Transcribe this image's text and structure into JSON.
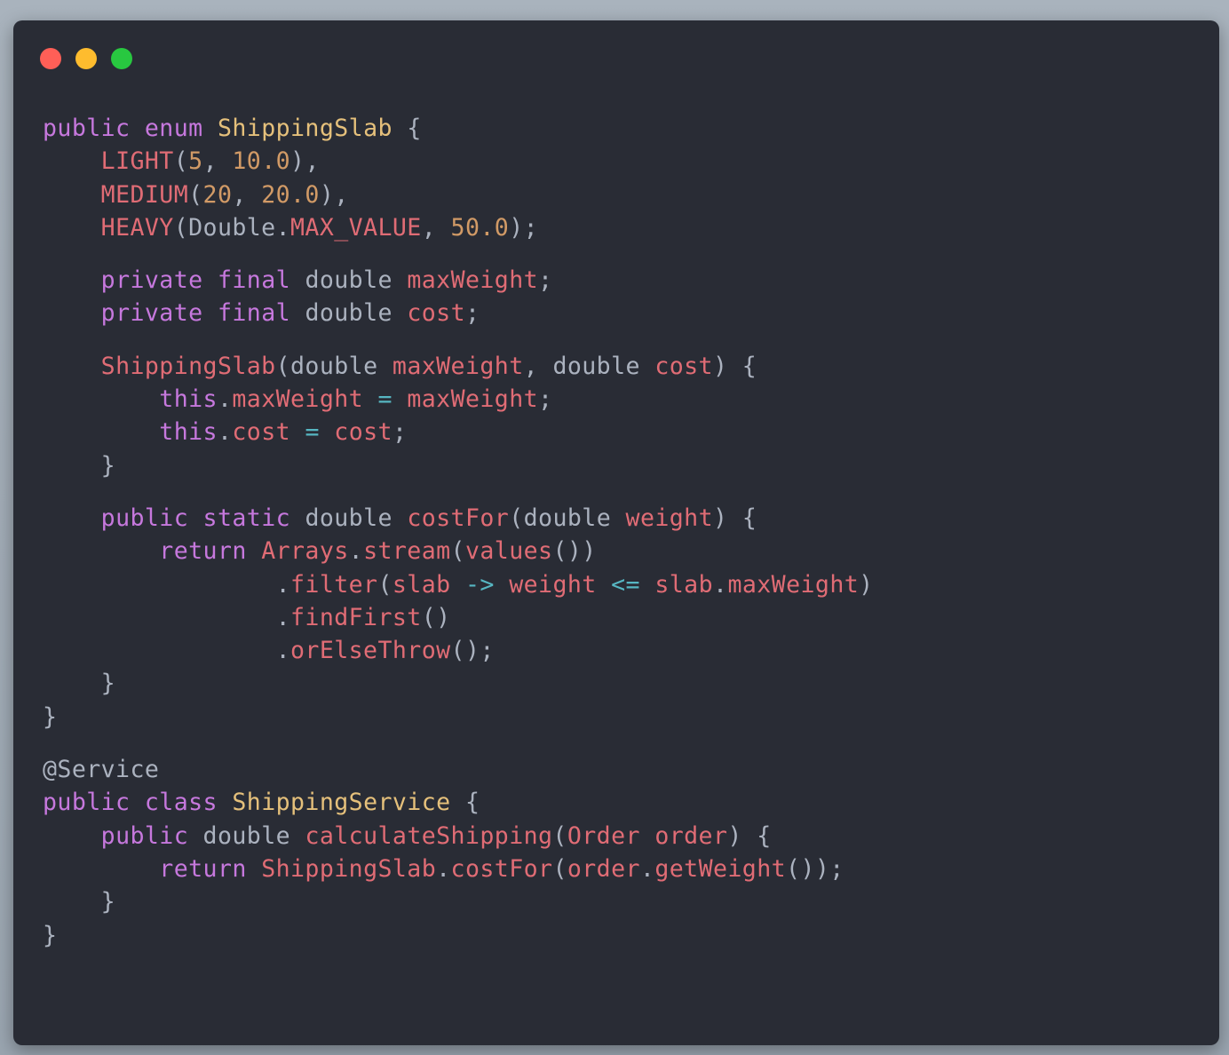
{
  "window": {
    "traffic_lights": [
      {
        "name": "close",
        "color": "#ff5f57"
      },
      {
        "name": "minimize",
        "color": "#febc2e"
      },
      {
        "name": "zoom",
        "color": "#28c840"
      }
    ]
  },
  "code": {
    "language": "java",
    "lines": [
      {
        "gap": false,
        "tokens": [
          {
            "t": "kw",
            "v": "public"
          },
          {
            "t": "plain",
            "v": " "
          },
          {
            "t": "kw",
            "v": "enum"
          },
          {
            "t": "plain",
            "v": " "
          },
          {
            "t": "type",
            "v": "ShippingSlab"
          },
          {
            "t": "punc",
            "v": " {"
          }
        ]
      },
      {
        "gap": false,
        "tokens": [
          {
            "t": "plain",
            "v": "    "
          },
          {
            "t": "const",
            "v": "LIGHT"
          },
          {
            "t": "punc",
            "v": "("
          },
          {
            "t": "num",
            "v": "5"
          },
          {
            "t": "punc",
            "v": ", "
          },
          {
            "t": "num",
            "v": "10.0"
          },
          {
            "t": "punc",
            "v": "),"
          }
        ]
      },
      {
        "gap": false,
        "tokens": [
          {
            "t": "plain",
            "v": "    "
          },
          {
            "t": "const",
            "v": "MEDIUM"
          },
          {
            "t": "punc",
            "v": "("
          },
          {
            "t": "num",
            "v": "20"
          },
          {
            "t": "punc",
            "v": ", "
          },
          {
            "t": "num",
            "v": "20.0"
          },
          {
            "t": "punc",
            "v": "),"
          }
        ]
      },
      {
        "gap": false,
        "tokens": [
          {
            "t": "plain",
            "v": "    "
          },
          {
            "t": "const",
            "v": "HEAVY"
          },
          {
            "t": "punc",
            "v": "(Double."
          },
          {
            "t": "const",
            "v": "MAX_VALUE"
          },
          {
            "t": "punc",
            "v": ", "
          },
          {
            "t": "num",
            "v": "50.0"
          },
          {
            "t": "punc",
            "v": ");"
          }
        ]
      },
      {
        "gap": true,
        "tokens": []
      },
      {
        "gap": false,
        "tokens": [
          {
            "t": "plain",
            "v": "    "
          },
          {
            "t": "kw",
            "v": "private"
          },
          {
            "t": "plain",
            "v": " "
          },
          {
            "t": "kw",
            "v": "final"
          },
          {
            "t": "plain",
            "v": " "
          },
          {
            "t": "prim",
            "v": "double"
          },
          {
            "t": "plain",
            "v": " "
          },
          {
            "t": "field",
            "v": "maxWeight"
          },
          {
            "t": "punc",
            "v": ";"
          }
        ]
      },
      {
        "gap": false,
        "tokens": [
          {
            "t": "plain",
            "v": "    "
          },
          {
            "t": "kw",
            "v": "private"
          },
          {
            "t": "plain",
            "v": " "
          },
          {
            "t": "kw",
            "v": "final"
          },
          {
            "t": "plain",
            "v": " "
          },
          {
            "t": "prim",
            "v": "double"
          },
          {
            "t": "plain",
            "v": " "
          },
          {
            "t": "field",
            "v": "cost"
          },
          {
            "t": "punc",
            "v": ";"
          }
        ]
      },
      {
        "gap": true,
        "tokens": []
      },
      {
        "gap": false,
        "tokens": [
          {
            "t": "plain",
            "v": "    "
          },
          {
            "t": "fn",
            "v": "ShippingSlab"
          },
          {
            "t": "punc",
            "v": "("
          },
          {
            "t": "prim",
            "v": "double"
          },
          {
            "t": "plain",
            "v": " "
          },
          {
            "t": "field",
            "v": "maxWeight"
          },
          {
            "t": "punc",
            "v": ", "
          },
          {
            "t": "prim",
            "v": "double"
          },
          {
            "t": "plain",
            "v": " "
          },
          {
            "t": "field",
            "v": "cost"
          },
          {
            "t": "punc",
            "v": ") {"
          }
        ]
      },
      {
        "gap": false,
        "tokens": [
          {
            "t": "plain",
            "v": "        "
          },
          {
            "t": "kw",
            "v": "this"
          },
          {
            "t": "punc",
            "v": "."
          },
          {
            "t": "field",
            "v": "maxWeight"
          },
          {
            "t": "plain",
            "v": " "
          },
          {
            "t": "op",
            "v": "="
          },
          {
            "t": "plain",
            "v": " "
          },
          {
            "t": "field",
            "v": "maxWeight"
          },
          {
            "t": "punc",
            "v": ";"
          }
        ]
      },
      {
        "gap": false,
        "tokens": [
          {
            "t": "plain",
            "v": "        "
          },
          {
            "t": "kw",
            "v": "this"
          },
          {
            "t": "punc",
            "v": "."
          },
          {
            "t": "field",
            "v": "cost"
          },
          {
            "t": "plain",
            "v": " "
          },
          {
            "t": "op",
            "v": "="
          },
          {
            "t": "plain",
            "v": " "
          },
          {
            "t": "field",
            "v": "cost"
          },
          {
            "t": "punc",
            "v": ";"
          }
        ]
      },
      {
        "gap": false,
        "tokens": [
          {
            "t": "plain",
            "v": "    "
          },
          {
            "t": "punc",
            "v": "}"
          }
        ]
      },
      {
        "gap": true,
        "tokens": []
      },
      {
        "gap": false,
        "tokens": [
          {
            "t": "plain",
            "v": "    "
          },
          {
            "t": "kw",
            "v": "public"
          },
          {
            "t": "plain",
            "v": " "
          },
          {
            "t": "kw",
            "v": "static"
          },
          {
            "t": "plain",
            "v": " "
          },
          {
            "t": "prim",
            "v": "double"
          },
          {
            "t": "plain",
            "v": " "
          },
          {
            "t": "fn",
            "v": "costFor"
          },
          {
            "t": "punc",
            "v": "("
          },
          {
            "t": "prim",
            "v": "double"
          },
          {
            "t": "plain",
            "v": " "
          },
          {
            "t": "field",
            "v": "weight"
          },
          {
            "t": "punc",
            "v": ") {"
          }
        ]
      },
      {
        "gap": false,
        "tokens": [
          {
            "t": "plain",
            "v": "        "
          },
          {
            "t": "kw",
            "v": "return"
          },
          {
            "t": "plain",
            "v": " "
          },
          {
            "t": "fn",
            "v": "Arrays"
          },
          {
            "t": "punc",
            "v": "."
          },
          {
            "t": "fn",
            "v": "stream"
          },
          {
            "t": "punc",
            "v": "("
          },
          {
            "t": "fn",
            "v": "values"
          },
          {
            "t": "punc",
            "v": "())"
          }
        ]
      },
      {
        "gap": false,
        "tokens": [
          {
            "t": "plain",
            "v": "                "
          },
          {
            "t": "punc",
            "v": "."
          },
          {
            "t": "fn",
            "v": "filter"
          },
          {
            "t": "punc",
            "v": "("
          },
          {
            "t": "field",
            "v": "slab"
          },
          {
            "t": "plain",
            "v": " "
          },
          {
            "t": "op",
            "v": "->"
          },
          {
            "t": "plain",
            "v": " "
          },
          {
            "t": "field",
            "v": "weight"
          },
          {
            "t": "plain",
            "v": " "
          },
          {
            "t": "op",
            "v": "<="
          },
          {
            "t": "plain",
            "v": " "
          },
          {
            "t": "field",
            "v": "slab"
          },
          {
            "t": "punc",
            "v": "."
          },
          {
            "t": "field",
            "v": "maxWeight"
          },
          {
            "t": "punc",
            "v": ")"
          }
        ]
      },
      {
        "gap": false,
        "tokens": [
          {
            "t": "plain",
            "v": "                "
          },
          {
            "t": "punc",
            "v": "."
          },
          {
            "t": "fn",
            "v": "findFirst"
          },
          {
            "t": "punc",
            "v": "()"
          }
        ]
      },
      {
        "gap": false,
        "tokens": [
          {
            "t": "plain",
            "v": "                "
          },
          {
            "t": "punc",
            "v": "."
          },
          {
            "t": "fn",
            "v": "orElseThrow"
          },
          {
            "t": "punc",
            "v": "();"
          }
        ]
      },
      {
        "gap": false,
        "tokens": [
          {
            "t": "plain",
            "v": "    "
          },
          {
            "t": "punc",
            "v": "}"
          }
        ]
      },
      {
        "gap": false,
        "tokens": [
          {
            "t": "punc",
            "v": "}"
          }
        ]
      },
      {
        "gap": true,
        "tokens": []
      },
      {
        "gap": false,
        "tokens": [
          {
            "t": "ann",
            "v": "@Service"
          }
        ]
      },
      {
        "gap": false,
        "tokens": [
          {
            "t": "kw",
            "v": "public"
          },
          {
            "t": "plain",
            "v": " "
          },
          {
            "t": "kw",
            "v": "class"
          },
          {
            "t": "plain",
            "v": " "
          },
          {
            "t": "type",
            "v": "ShippingService"
          },
          {
            "t": "punc",
            "v": " {"
          }
        ]
      },
      {
        "gap": false,
        "tokens": [
          {
            "t": "plain",
            "v": "    "
          },
          {
            "t": "kw",
            "v": "public"
          },
          {
            "t": "plain",
            "v": " "
          },
          {
            "t": "prim",
            "v": "double"
          },
          {
            "t": "plain",
            "v": " "
          },
          {
            "t": "fn",
            "v": "calculateShipping"
          },
          {
            "t": "punc",
            "v": "("
          },
          {
            "t": "field",
            "v": "Order"
          },
          {
            "t": "plain",
            "v": " "
          },
          {
            "t": "field",
            "v": "order"
          },
          {
            "t": "punc",
            "v": ") {"
          }
        ]
      },
      {
        "gap": false,
        "tokens": [
          {
            "t": "plain",
            "v": "        "
          },
          {
            "t": "kw",
            "v": "return"
          },
          {
            "t": "plain",
            "v": " "
          },
          {
            "t": "fn",
            "v": "ShippingSlab"
          },
          {
            "t": "punc",
            "v": "."
          },
          {
            "t": "fn",
            "v": "costFor"
          },
          {
            "t": "punc",
            "v": "("
          },
          {
            "t": "field",
            "v": "order"
          },
          {
            "t": "punc",
            "v": "."
          },
          {
            "t": "fn",
            "v": "getWeight"
          },
          {
            "t": "punc",
            "v": "());"
          }
        ]
      },
      {
        "gap": false,
        "tokens": [
          {
            "t": "plain",
            "v": "    "
          },
          {
            "t": "punc",
            "v": "}"
          }
        ]
      },
      {
        "gap": false,
        "tokens": [
          {
            "t": "punc",
            "v": "}"
          }
        ]
      }
    ]
  }
}
